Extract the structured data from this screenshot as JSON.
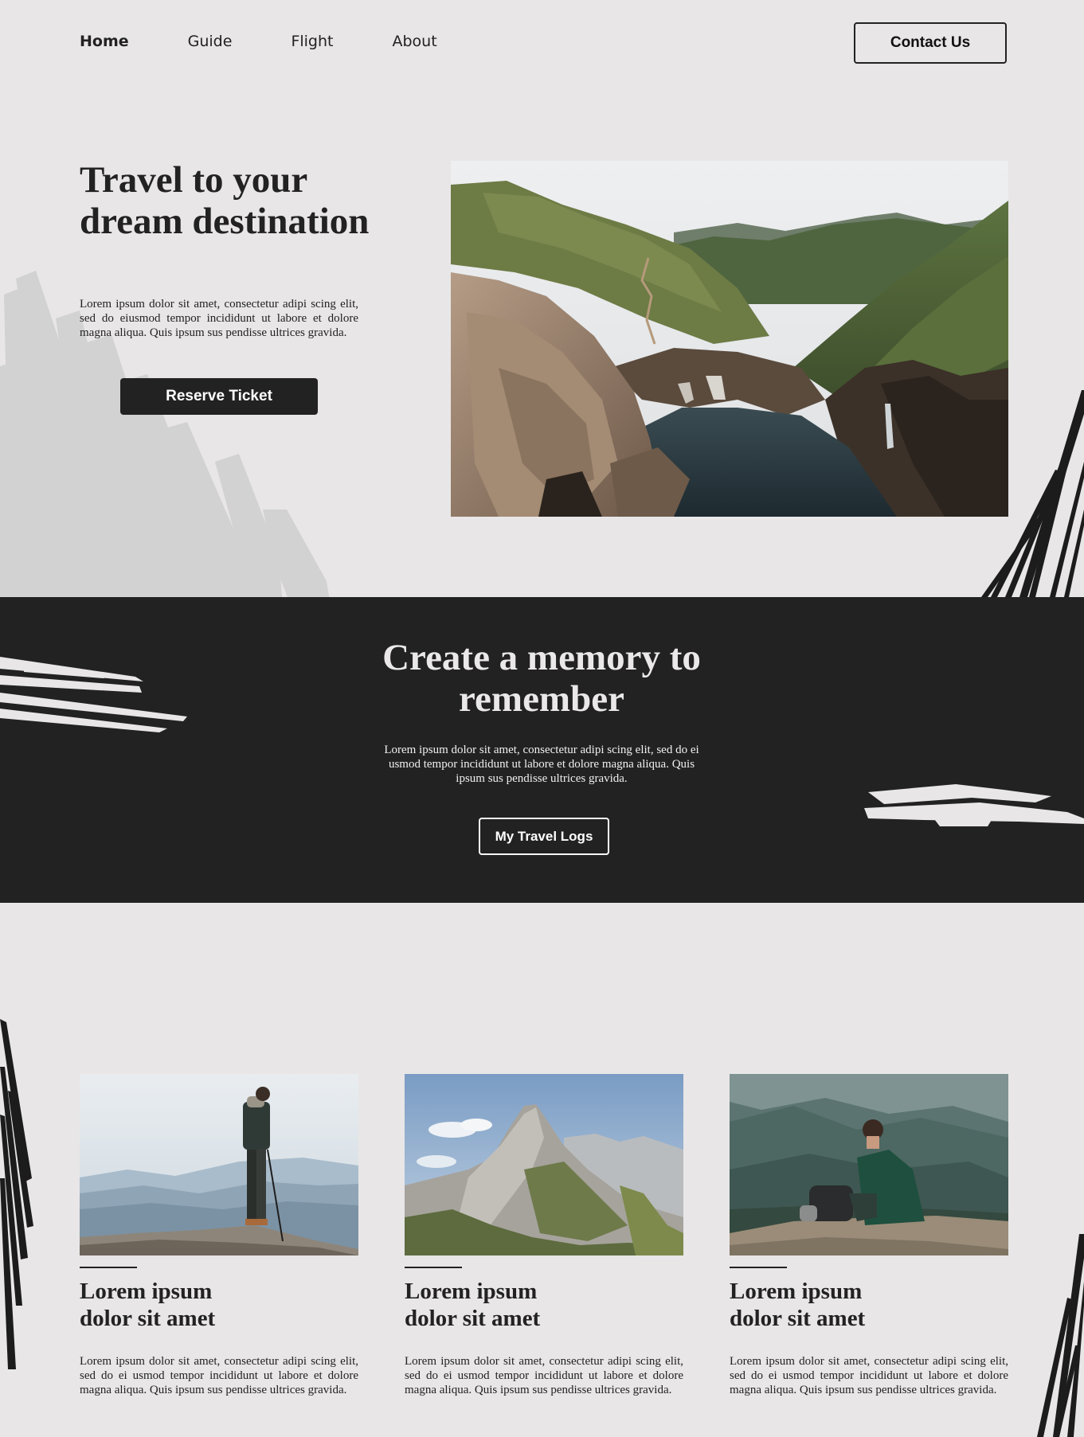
{
  "nav": {
    "links": [
      {
        "label": "Home",
        "active": true
      },
      {
        "label": "Guide",
        "active": false
      },
      {
        "label": "Flight",
        "active": false
      },
      {
        "label": "About",
        "active": false
      }
    ],
    "contact_label": "Contact Us"
  },
  "hero": {
    "title": "Travel to your dream destination",
    "text": "Lorem ipsum dolor sit amet, consectetur adipi scing elit, sed do eiusmod tempor incididunt ut labore et dolore magna aliqua. Quis ipsum sus pendisse ultrices gravida.",
    "button_label": "Reserve Ticket",
    "photo": "coastal-canyon-photo"
  },
  "band": {
    "title": "Create a memory to remember",
    "text": "Lorem ipsum dolor sit amet, consectetur adipi scing elit, sed do ei usmod tempor incididunt ut labore et dolore magna aliqua. Quis ipsum sus pendisse ultrices gravida.",
    "button_label": "My Travel Logs"
  },
  "cards": [
    {
      "photo": "hiker-on-summit-photo",
      "title": "Lorem ipsum dolor sit amet",
      "text": "Lorem ipsum dolor sit amet, consectetur adipi scing elit, sed do ei usmod tempor incididunt ut labore et dolore magna aliqua. Quis ipsum sus pendisse ultrices gravida."
    },
    {
      "photo": "rocky-peak-photo",
      "title": "Lorem ipsum dolor sit amet",
      "text": "Lorem ipsum dolor sit amet, consectetur adipi scing elit, sed do ei usmod tempor incididunt ut labore et dolore magna aliqua. Quis ipsum sus pendisse ultrices gravida."
    },
    {
      "photo": "seated-hiker-valley-photo",
      "title": "Lorem ipsum dolor sit amet",
      "text": "Lorem ipsum dolor sit amet, consectetur adipi scing elit, sed do ei usmod tempor incididunt ut labore et dolore magna aliqua. Quis ipsum sus pendisse ultrices gravida."
    }
  ],
  "colors": {
    "page_bg": "#e8e6e7",
    "dark": "#222222",
    "light_text": "#eae8e9"
  }
}
